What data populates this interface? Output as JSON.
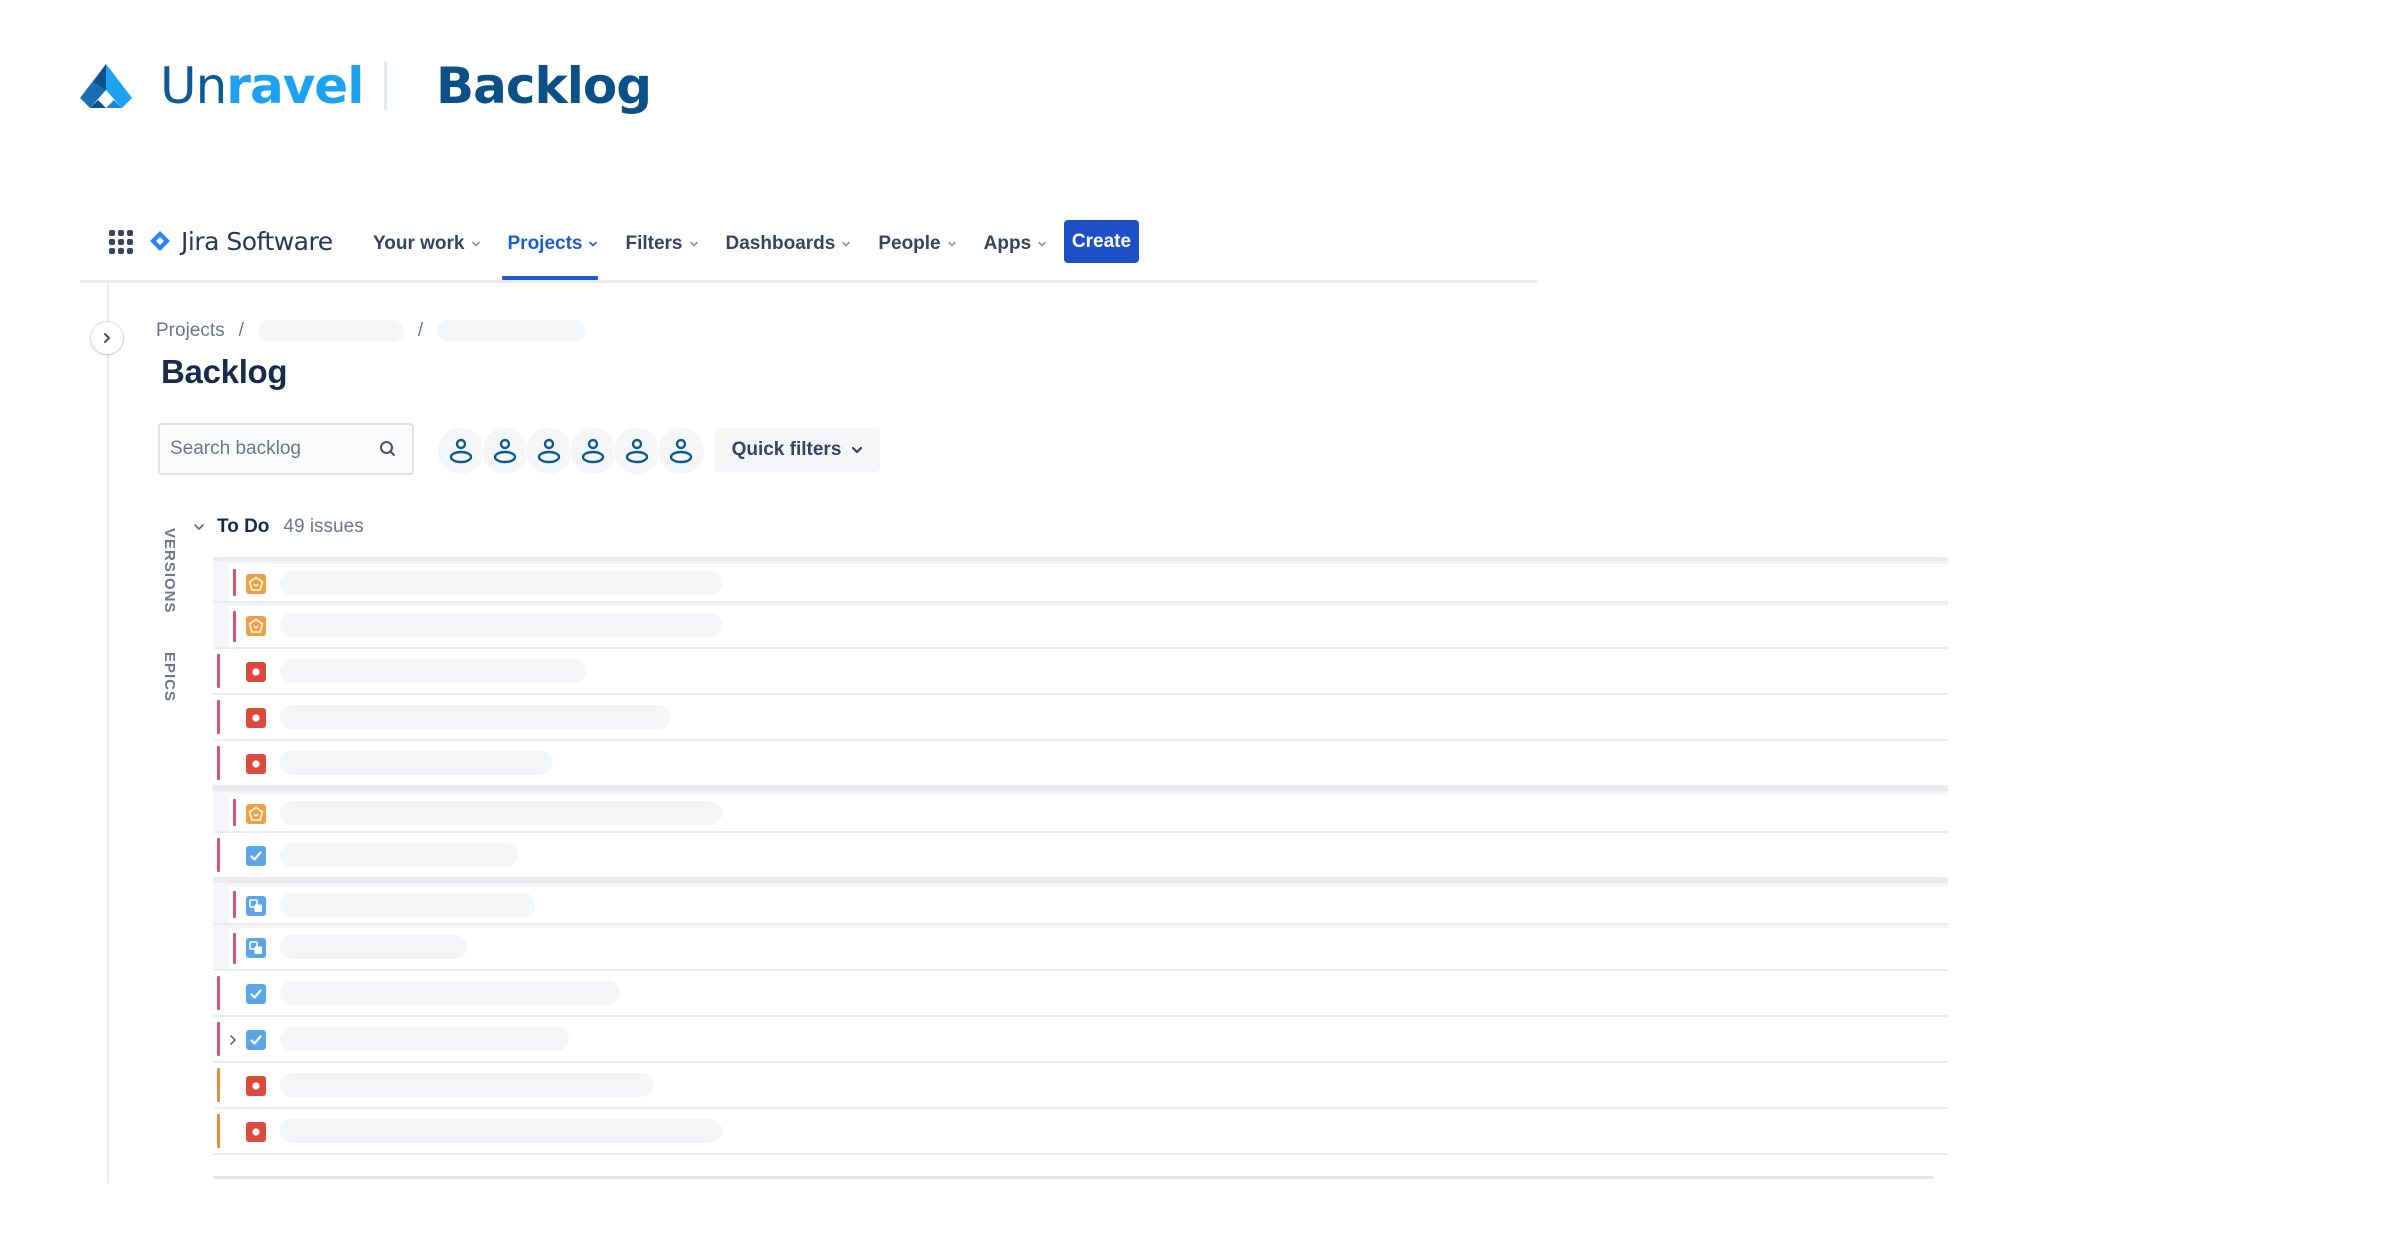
{
  "brand": {
    "logo_icon": "unravel-logo-icon",
    "name_lead": "Un",
    "name_accent": "ravel",
    "page": "Backlog",
    "colors": {
      "dark": "#0e5a96",
      "light": "#1da1f2"
    }
  },
  "nav": {
    "app_switcher_icon": "grid-icon",
    "product_icon": "jira-diamond-icon",
    "product": "Jira Software",
    "items": [
      {
        "label": "Your work",
        "active": false
      },
      {
        "label": "Projects",
        "active": true
      },
      {
        "label": "Filters",
        "active": false
      },
      {
        "label": "Dashboards",
        "active": false
      },
      {
        "label": "People",
        "active": false
      },
      {
        "label": "Apps",
        "active": false
      }
    ],
    "create_label": "Create",
    "accent": "#1d4fc6"
  },
  "breadcrumb": {
    "root": "Projects",
    "separator": "/"
  },
  "page_title": "Backlog",
  "toolbar": {
    "search_placeholder": "Search backlog",
    "avatar_count": 6,
    "quick_filters_label": "Quick filters"
  },
  "side_tabs": {
    "versions": "VERSIONS",
    "epics": "EPICS"
  },
  "sprint": {
    "title": "To Do",
    "count": "49 issues",
    "rows": [
      {
        "type": "story-epic",
        "icon": "pentagon-icon",
        "bar": "#d25868",
        "grouped": true,
        "group_start": true,
        "placeholder": 0.26
      },
      {
        "type": "story-epic",
        "icon": "pentagon-icon",
        "bar": "#d25868",
        "grouped": true,
        "group_start": false,
        "placeholder": 0.26
      },
      {
        "type": "bug",
        "icon": "bug-icon",
        "bar": "#d25868",
        "grouped": false,
        "group_start": false,
        "placeholder": 0.18
      },
      {
        "type": "bug",
        "icon": "bug-icon",
        "bar": "#d25868",
        "grouped": false,
        "group_start": false,
        "placeholder": 0.23
      },
      {
        "type": "bug",
        "icon": "bug-icon",
        "bar": "#d25868",
        "grouped": false,
        "group_start": false,
        "placeholder": 0.16
      },
      {
        "type": "story-epic",
        "icon": "pentagon-icon",
        "bar": "#d25868",
        "grouped": true,
        "group_start": true,
        "placeholder": 0.26
      },
      {
        "type": "task",
        "icon": "checkbox-icon",
        "bar": "#d25868",
        "grouped": false,
        "group_start": false,
        "placeholder": 0.14
      },
      {
        "type": "subtask",
        "icon": "subtask-icon",
        "bar": "#d25868",
        "grouped": true,
        "group_start": true,
        "placeholder": 0.15
      },
      {
        "type": "subtask",
        "icon": "subtask-icon",
        "bar": "#d25868",
        "grouped": true,
        "group_start": false,
        "placeholder": 0.11
      },
      {
        "type": "task",
        "icon": "checkbox-icon",
        "bar": "#d25868",
        "grouped": false,
        "group_start": false,
        "placeholder": 0.2
      },
      {
        "type": "task",
        "icon": "checkbox-icon",
        "bar": "#d25868",
        "grouped": false,
        "group_start": false,
        "placeholder": 0.17,
        "expandable": true
      },
      {
        "type": "bug",
        "icon": "bug-icon",
        "bar": "#e0903a",
        "grouped": false,
        "group_start": false,
        "placeholder": 0.22
      },
      {
        "type": "bug",
        "icon": "bug-icon",
        "bar": "#e0903a",
        "grouped": false,
        "group_start": false,
        "placeholder": 0.26
      }
    ]
  },
  "type_colors": {
    "story-epic": "#f0a040",
    "bug": "#db4b3d",
    "task": "#5ba4e6",
    "subtask": "#5ba4e6"
  }
}
